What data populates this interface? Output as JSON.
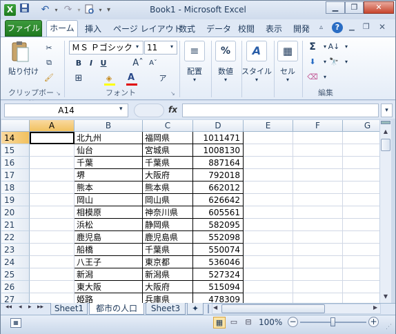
{
  "window": {
    "title": "Book1 - Microsoft Excel"
  },
  "tabs": {
    "file": "ファイル",
    "home": "ホーム",
    "items": [
      "挿入",
      "ページ レイアウト",
      "数式",
      "データ",
      "校閲",
      "表示",
      "開発"
    ]
  },
  "ribbon": {
    "clipboard": {
      "paste": "貼り付け",
      "label": "クリップボード"
    },
    "font": {
      "name": "ＭＳ Ｐゴシック",
      "size": "11",
      "label": "フォント"
    },
    "alignment": {
      "label": "配置"
    },
    "number": {
      "label": "数値"
    },
    "styles": {
      "label": "スタイル"
    },
    "cells": {
      "label": "セル"
    },
    "editing": {
      "label": "編集"
    }
  },
  "formula_bar": {
    "name_box": "A14",
    "fx": "fx",
    "formula": ""
  },
  "columns": [
    "A",
    "B",
    "C",
    "D",
    "E",
    "F",
    "G"
  ],
  "rows": [
    {
      "n": "14",
      "city": "北九州",
      "pref": "福岡県",
      "pop": "1011471"
    },
    {
      "n": "15",
      "city": "仙台",
      "pref": "宮城県",
      "pop": "1008130"
    },
    {
      "n": "16",
      "city": "千葉",
      "pref": "千葉県",
      "pop": "887164"
    },
    {
      "n": "17",
      "city": "堺",
      "pref": "大阪府",
      "pop": "792018"
    },
    {
      "n": "18",
      "city": "熊本",
      "pref": "熊本県",
      "pop": "662012"
    },
    {
      "n": "19",
      "city": "岡山",
      "pref": "岡山県",
      "pop": "626642"
    },
    {
      "n": "20",
      "city": "相模原",
      "pref": "神奈川県",
      "pop": "605561"
    },
    {
      "n": "21",
      "city": "浜松",
      "pref": "静岡県",
      "pop": "582095"
    },
    {
      "n": "22",
      "city": "鹿児島",
      "pref": "鹿児島県",
      "pop": "552098"
    },
    {
      "n": "23",
      "city": "船橋",
      "pref": "千葉県",
      "pop": "550074"
    },
    {
      "n": "24",
      "city": "八王子",
      "pref": "東京都",
      "pop": "536046"
    },
    {
      "n": "25",
      "city": "新潟",
      "pref": "新潟県",
      "pop": "527324"
    },
    {
      "n": "26",
      "city": "東大阪",
      "pref": "大阪府",
      "pop": "515094"
    },
    {
      "n": "27",
      "city": "姫路",
      "pref": "兵庫県",
      "pop": "478309"
    }
  ],
  "sheets": [
    "Sheet1",
    "都市の人口",
    "Sheet3"
  ],
  "status": {
    "zoom": "100%"
  }
}
